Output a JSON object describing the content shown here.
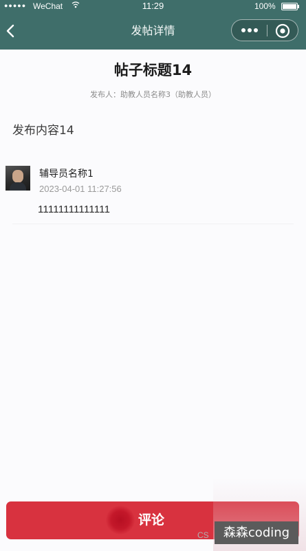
{
  "status_bar": {
    "signal": "●●●●●",
    "carrier": "WeChat",
    "time": "11:29",
    "battery_percent": "100%",
    "battery_level": 1.0
  },
  "nav": {
    "title": "发帖详情",
    "back_icon": "chevron-left-icon",
    "more_icon": "more-dots-icon",
    "close_icon": "target-close-icon"
  },
  "post": {
    "title": "帖子标题14",
    "author_line": "发布人：助教人员名称3（助教人员）",
    "content": "发布内容14"
  },
  "comments": [
    {
      "name": "辅导员名称1",
      "time": "2023-04-01 11:27:56",
      "text": "11111111111111"
    }
  ],
  "actions": {
    "comment_label": "评论"
  },
  "watermark": {
    "prefix": "CS",
    "text": "森森coding"
  },
  "colors": {
    "nav_bg": "#3f6e6a",
    "accent_red": "#d8323f"
  }
}
